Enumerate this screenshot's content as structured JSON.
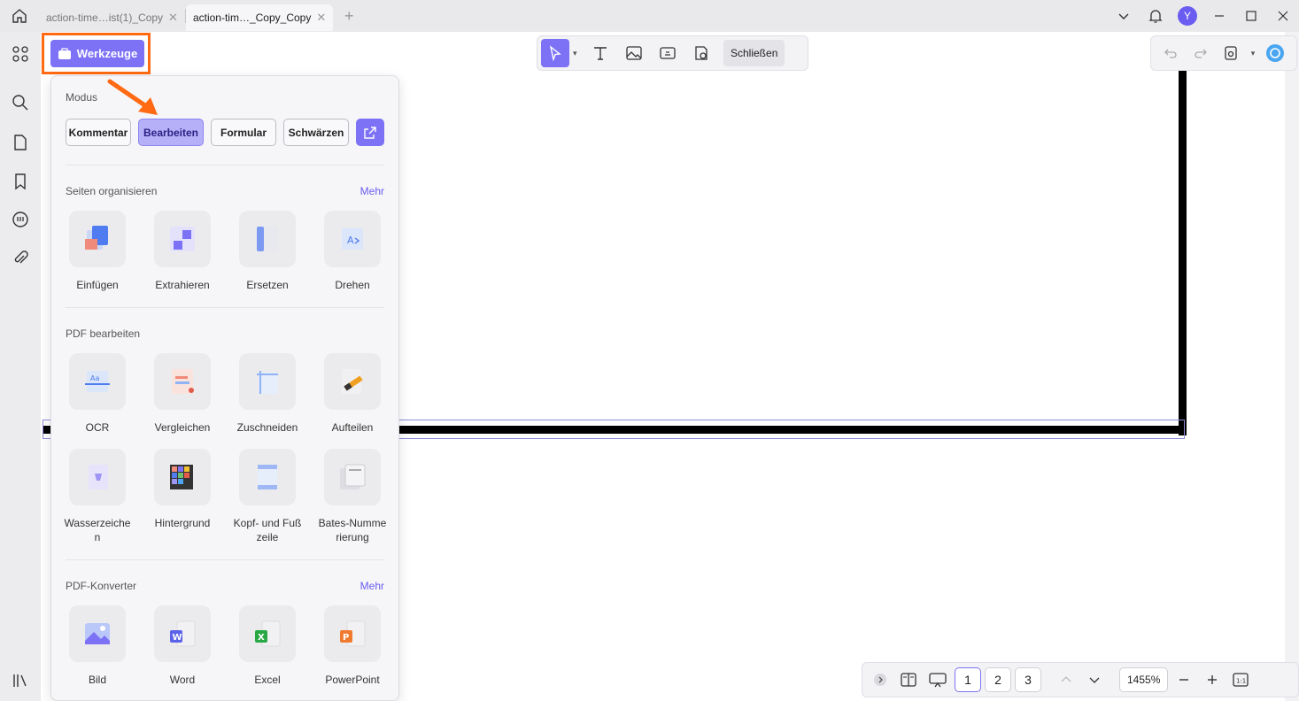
{
  "titlebar": {
    "tabs": [
      {
        "label": "action-time…ist(1)_Copy"
      },
      {
        "label": "action-tim…_Copy_Copy"
      }
    ],
    "avatar_letter": "Y"
  },
  "tools_button": {
    "label": "Werkzeuge"
  },
  "edit_toolbar": {
    "close_label": "Schließen"
  },
  "panel": {
    "mode": {
      "title": "Modus",
      "buttons": [
        "Kommentar",
        "Bearbeiten",
        "Formular",
        "Schwärzen"
      ],
      "active": "Bearbeiten"
    },
    "organize": {
      "title": "Seiten organisieren",
      "more": "Mehr",
      "tools": [
        "Einfügen",
        "Extrahieren",
        "Ersetzen",
        "Drehen"
      ]
    },
    "edit": {
      "title": "PDF bearbeiten",
      "tools_row1": [
        "OCR",
        "Vergleichen",
        "Zuschneiden",
        "Aufteilen"
      ],
      "tools_row2": [
        "Wasserzeichen",
        "Hintergrund",
        "Kopf- und Fußzeile",
        "Bates-Nummerierung"
      ]
    },
    "converter": {
      "title": "PDF-Konverter",
      "more": "Mehr",
      "tools": [
        "Bild",
        "Word",
        "Excel",
        "PowerPoint"
      ]
    }
  },
  "bottombar": {
    "pages": [
      "1",
      "2",
      "3"
    ],
    "current_page": "1",
    "zoom": "1455%"
  },
  "colors": {
    "accent": "#7d72f5",
    "highlight": "#ff6a13"
  }
}
